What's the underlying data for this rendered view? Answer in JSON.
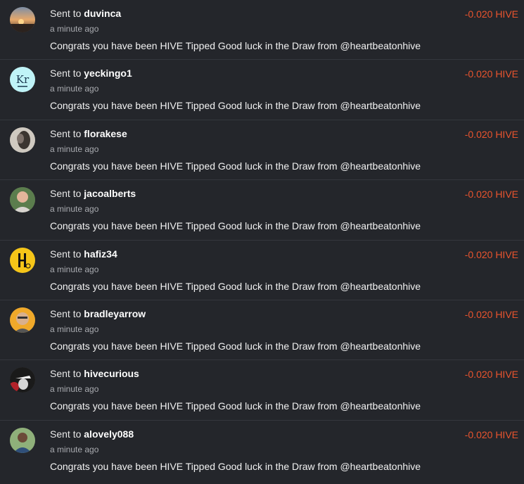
{
  "transfers": [
    {
      "prefix": "Sent to",
      "user": "duvinca",
      "time": "a minute ago",
      "memo": "Congrats you have been HIVE Tipped Good luck in the Draw from @heartbeatonhive",
      "amount": "-0.020 HIVE",
      "avatar": "sunset-photo"
    },
    {
      "prefix": "Sent to",
      "user": "yeckingo1",
      "time": "a minute ago",
      "memo": "Congrats you have been HIVE Tipped Good luck in the Draw from @heartbeatonhive",
      "amount": "-0.020 HIVE",
      "avatar": "kr-logo",
      "avatar_text": "Kr"
    },
    {
      "prefix": "Sent to",
      "user": "florakese",
      "time": "a minute ago",
      "memo": "Congrats you have been HIVE Tipped Good luck in the Draw from @heartbeatonhive",
      "amount": "-0.020 HIVE",
      "avatar": "portrait-photo"
    },
    {
      "prefix": "Sent to",
      "user": "jacoalberts",
      "time": "a minute ago",
      "memo": "Congrats you have been HIVE Tipped Good luck in the Draw from @heartbeatonhive",
      "amount": "-0.020 HIVE",
      "avatar": "person-photo"
    },
    {
      "prefix": "Sent to",
      "user": "hafiz34",
      "time": "a minute ago",
      "memo": "Congrats you have been HIVE Tipped Good luck in the Draw from @heartbeatonhive",
      "amount": "-0.020 HIVE",
      "avatar": "h-logo"
    },
    {
      "prefix": "Sent to",
      "user": "bradleyarrow",
      "time": "a minute ago",
      "memo": "Congrats you have been HIVE Tipped Good luck in the Draw from @heartbeatonhive",
      "amount": "-0.020 HIVE",
      "avatar": "person-photo"
    },
    {
      "prefix": "Sent to",
      "user": "hivecurious",
      "time": "a minute ago",
      "memo": "Congrats you have been HIVE Tipped Good luck in the Draw from @heartbeatonhive",
      "amount": "-0.020 HIVE",
      "avatar": "hat-silhouette"
    },
    {
      "prefix": "Sent to",
      "user": "alovely088",
      "time": "a minute ago",
      "memo": "Congrats you have been HIVE Tipped Good luck in the Draw from @heartbeatonhive",
      "amount": "-0.020 HIVE",
      "avatar": "person-photo"
    }
  ],
  "colors": {
    "background": "#24262b",
    "amount": "#e8542e",
    "divider": "#34373d"
  }
}
